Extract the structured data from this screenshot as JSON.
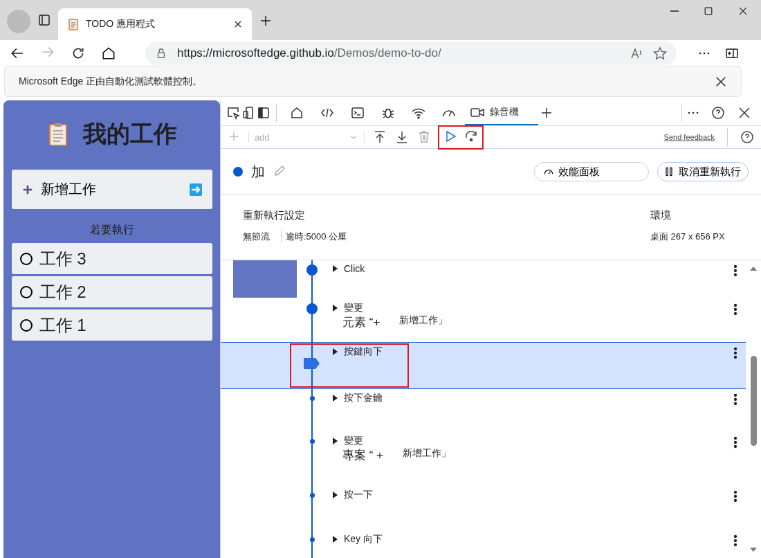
{
  "browser": {
    "tab_title": "TODO 應用程式",
    "url_host": "https://microsoftedge.github.io",
    "url_path": "/Demos/demo-to-do/"
  },
  "infobar": {
    "message": "Microsoft Edge 正由自動化測試軟體控制。"
  },
  "app": {
    "title": "我的工作",
    "add_task": "新增工作",
    "section": "若要執行",
    "tasks": [
      {
        "label": "工作 3",
        "done": false
      },
      {
        "label": "工作 2",
        "done": false
      },
      {
        "label": "工作 1",
        "done": false
      }
    ]
  },
  "devtools": {
    "tabs": [
      {
        "kind": "home",
        "selected": false
      },
      {
        "kind": "code",
        "selected": false
      },
      {
        "kind": "console",
        "selected": false
      },
      {
        "kind": "bug",
        "selected": false
      },
      {
        "kind": "wifi",
        "selected": false
      },
      {
        "kind": "gauge",
        "selected": false
      },
      {
        "kind": "camera",
        "label": "錄音機",
        "selected": true
      }
    ],
    "toolbar": {
      "step_placeholder": "add",
      "send_feedback": "Send feedback",
      "replay_callout": true
    },
    "recording": {
      "name": "加",
      "performance_panel": "效能面板",
      "cancel_replay": "取消重新執行"
    },
    "settings": {
      "heading": "重新執行設定",
      "throttling": "無節流",
      "timeout": "逾時:5000 公厘",
      "env_heading": "環境",
      "env_value": "桌面 267 x 656 PX"
    },
    "steps": [
      {
        "kind": "big",
        "title": "Click",
        "selected": false,
        "callout": false
      },
      {
        "kind": "big",
        "title": "變更",
        "detail": "元素 “+",
        "target": "新增工作」",
        "selected": false,
        "callout": false
      },
      {
        "kind": "current",
        "title": "按鍵向下",
        "selected": true,
        "callout": true
      },
      {
        "kind": "small",
        "title": "按下金鑰",
        "selected": false,
        "callout": false
      },
      {
        "kind": "small",
        "title": "變更",
        "detail": "專案 “ +",
        "target": "新增工作」",
        "selected": false,
        "callout": false
      },
      {
        "kind": "small",
        "title": "按一下",
        "selected": false,
        "callout": false
      },
      {
        "kind": "small",
        "title": "Key 向下",
        "selected": false,
        "callout": false
      }
    ]
  }
}
